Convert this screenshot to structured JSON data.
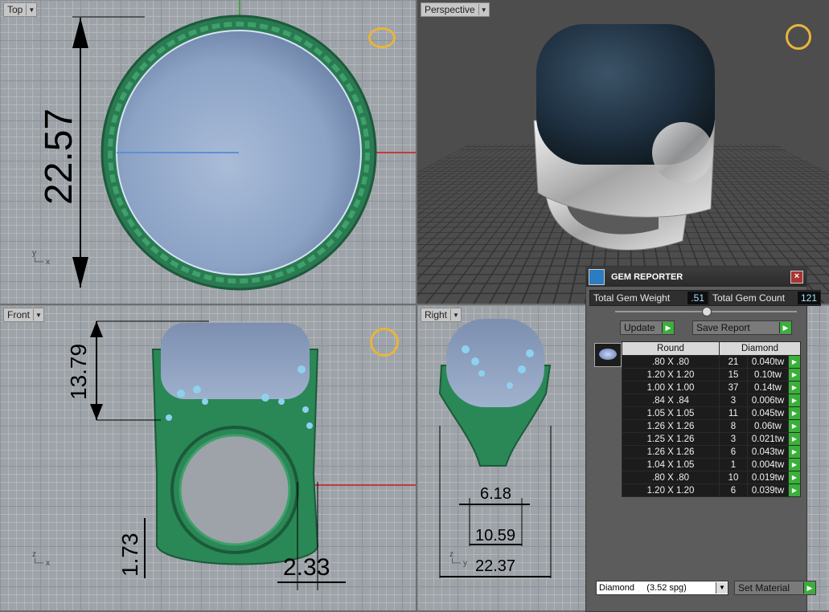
{
  "viewports": {
    "top": {
      "label": "Top",
      "dimension": "22.57"
    },
    "perspective": {
      "label": "Perspective"
    },
    "front": {
      "label": "Front",
      "dim_height": "13.79",
      "dim_shank": "1.73",
      "dim_width": "2.33"
    },
    "right": {
      "label": "Right",
      "dim_a": "6.18",
      "dim_b": "10.59",
      "dim_c": "22.37"
    }
  },
  "gem_reporter": {
    "title": "GEM REPORTER",
    "total_weight_label": "Total Gem Weight",
    "total_weight_value": ".51",
    "total_count_label": "Total Gem Count",
    "total_count_value": "121",
    "update_label": "Update",
    "save_report_label": "Save Report",
    "columns": {
      "shape": "Round",
      "material": "Diamond"
    },
    "rows": [
      {
        "size": ".80 X .80",
        "count": "21",
        "weight": "0.040tw"
      },
      {
        "size": "1.20 X 1.20",
        "count": "15",
        "weight": "0.10tw"
      },
      {
        "size": "1.00 X 1.00",
        "count": "37",
        "weight": "0.14tw"
      },
      {
        "size": ".84 X .84",
        "count": "3",
        "weight": "0.006tw"
      },
      {
        "size": "1.05 X 1.05",
        "count": "11",
        "weight": "0.045tw"
      },
      {
        "size": "1.26 X 1.26",
        "count": "8",
        "weight": "0.06tw"
      },
      {
        "size": "1.25 X 1.26",
        "count": "3",
        "weight": "0.021tw"
      },
      {
        "size": "1.26 X 1.26",
        "count": "6",
        "weight": "0.043tw"
      },
      {
        "size": "1.04 X 1.05",
        "count": "1",
        "weight": "0.004tw"
      },
      {
        "size": ".80 X .80",
        "count": "10",
        "weight": "0.019tw"
      },
      {
        "size": "1.20 X 1.20",
        "count": "6",
        "weight": "0.039tw"
      }
    ],
    "material_select": "Diamond     (3.52 spg)",
    "set_material_label": "Set Material"
  },
  "colors": {
    "ring_green": "#2e8b57",
    "stone_blue": "#8fa6c8",
    "accent_green": "#39b03a"
  }
}
